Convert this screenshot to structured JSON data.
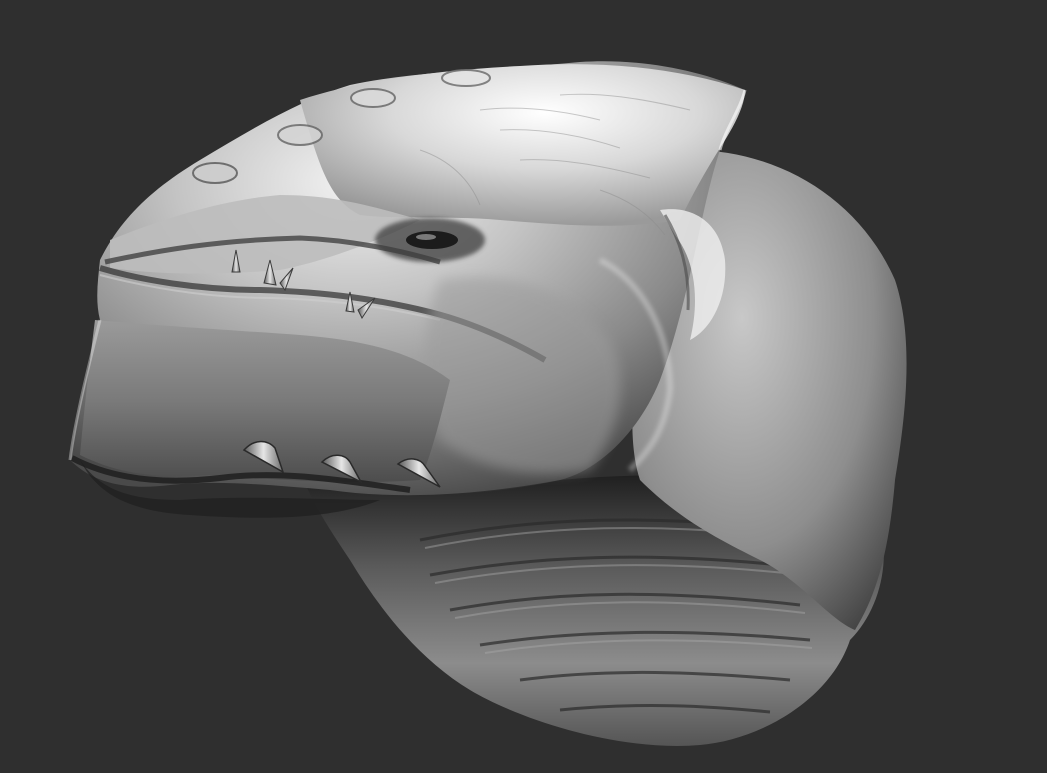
{
  "viewport": {
    "background_color": "#2f2f2f",
    "model_base_color": "#8e8e8e",
    "model_highlight_color": "#e8e8e8",
    "model_shadow_color": "#2a2a2a",
    "model_description_icon": "sculpted-creature-head-icon"
  }
}
